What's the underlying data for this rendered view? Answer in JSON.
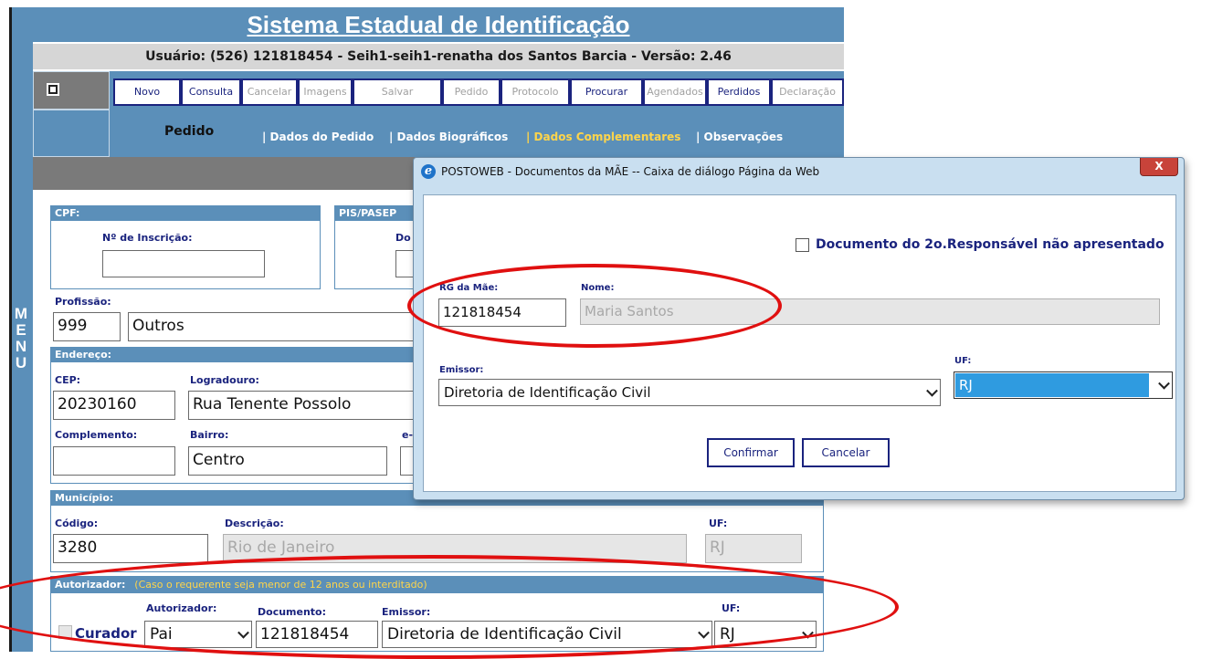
{
  "app": {
    "title": "Sistema Estadual de Identificação",
    "user_line": "Usuário: (526) 121818454 - Seih1-seih1-renatha dos Santos Barcia - Versão: 2.46",
    "menu_letters": [
      "M",
      "E",
      "N",
      "U"
    ]
  },
  "toolbar": {
    "buttons": [
      {
        "label": "Novo",
        "enabled": true
      },
      {
        "label": "Consulta",
        "enabled": true
      },
      {
        "label": "Cancelar",
        "enabled": false
      },
      {
        "label": "Imagens",
        "enabled": false
      },
      {
        "label": "Salvar",
        "enabled": false
      },
      {
        "label": "Pedido",
        "enabled": false
      },
      {
        "label": "Protocolo",
        "enabled": false
      },
      {
        "label": "Procurar",
        "enabled": true
      },
      {
        "label": "Agendados",
        "enabled": false
      },
      {
        "label": "Perdidos",
        "enabled": true
      },
      {
        "label": "Declaração",
        "enabled": false
      }
    ]
  },
  "tabs": {
    "section": "Pedido",
    "items": [
      "| Dados do Pedido",
      "| Dados Biográficos",
      "| Dados Complementares",
      "| Observações"
    ],
    "active_index": 2
  },
  "form": {
    "cpf": {
      "header": "CPF:",
      "inscricao_label": "Nº de Inscrição:",
      "inscricao_value": ""
    },
    "pis": {
      "header": "PIS/PASEP",
      "doc_label": "Do"
    },
    "profissao": {
      "label": "Profissão:",
      "code": "999",
      "name": "Outros"
    },
    "endereco": {
      "header": "Endereço:",
      "cep_label": "CEP:",
      "cep": "20230160",
      "logradouro_label": "Logradouro:",
      "logradouro": "Rua Tenente Possolo",
      "complemento_label": "Complemento:",
      "complemento": "",
      "bairro_label": "Bairro:",
      "bairro": "Centro",
      "email_label": "e-"
    },
    "municipio": {
      "header": "Município:",
      "codigo_label": "Código:",
      "codigo": "3280",
      "descricao_label": "Descrição:",
      "descricao": "Rio de Janeiro",
      "uf_label": "UF:",
      "uf": "RJ"
    },
    "autorizador": {
      "header": "Autorizador:",
      "note": "(Caso o requerente seja menor de 12 anos ou interditado)",
      "curador_label": "Curador",
      "autorizador_label": "Autorizador:",
      "autorizador": "Pai",
      "documento_label": "Documento:",
      "documento": "121818454",
      "emissor_label": "Emissor:",
      "emissor": "Diretoria de Identificação Civil",
      "uf_label": "UF:",
      "uf": "RJ"
    }
  },
  "dialog": {
    "title": "POSTOWEB - Documentos da MÃE -- Caixa de diálogo Página da Web",
    "close_label": "X",
    "checkbox_label": "Documento do 2o.Responsável não apresentado",
    "rg_label": "RG da Mãe:",
    "rg_value": "121818454",
    "nome_label": "Nome:",
    "nome_value": "Maria Santos",
    "emissor_label": "Emissor:",
    "emissor_value": "Diretoria de Identificação Civil",
    "uf_label": "UF:",
    "uf_value": "RJ",
    "confirm_label": "Confirmar",
    "cancel_label": "Cancelar"
  },
  "colors": {
    "header_blue": "#5b8fb9",
    "dialog_frame": "#c9dff0",
    "annotation_red": "#e01010",
    "active_tab": "#ffd54a",
    "selected_option": "#2f9be0"
  }
}
